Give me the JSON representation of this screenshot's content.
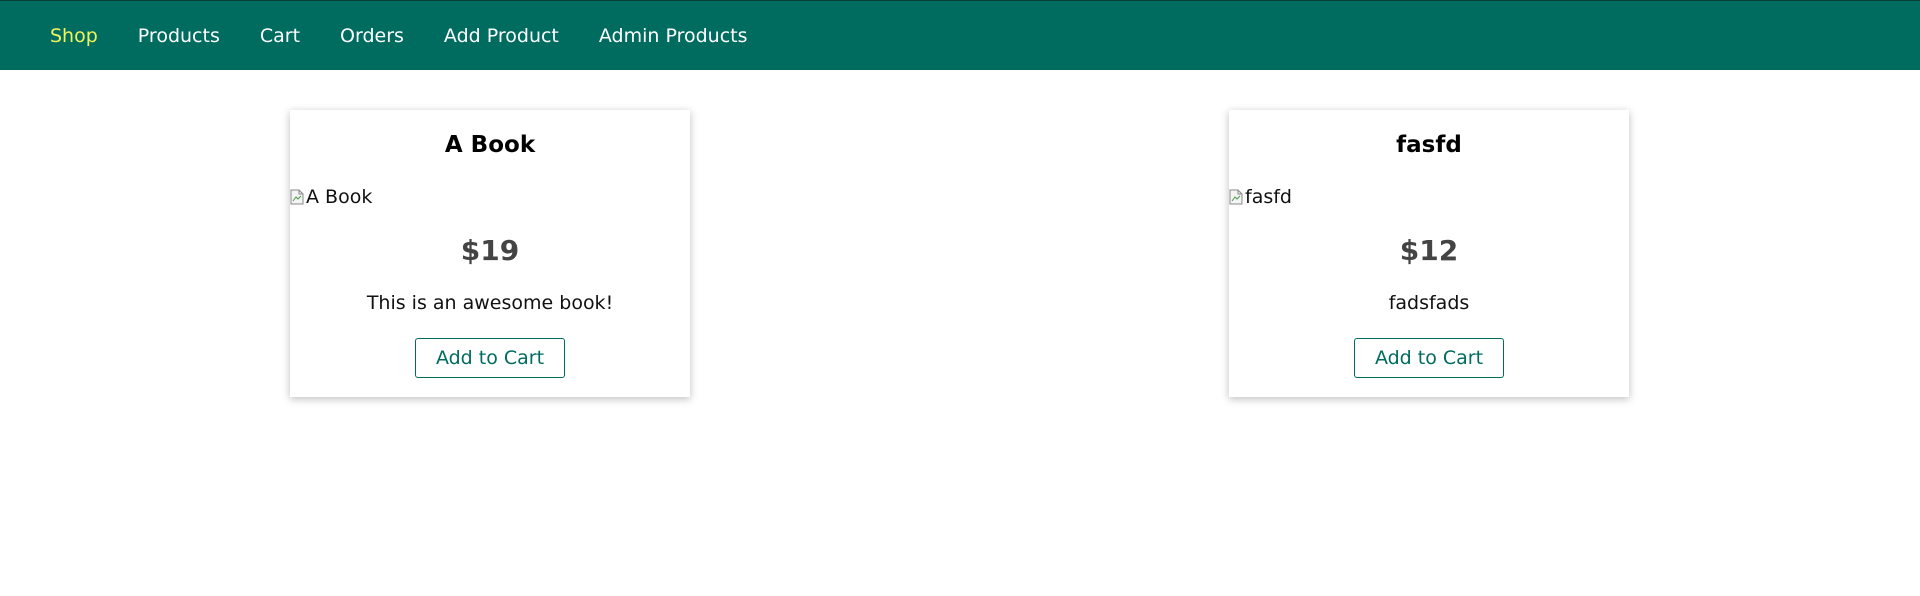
{
  "nav": {
    "items": [
      {
        "label": "Shop",
        "active": true
      },
      {
        "label": "Products",
        "active": false
      },
      {
        "label": "Cart",
        "active": false
      },
      {
        "label": "Orders",
        "active": false
      },
      {
        "label": "Add Product",
        "active": false
      },
      {
        "label": "Admin Products",
        "active": false
      }
    ]
  },
  "products": [
    {
      "title": "A Book",
      "image_alt": "A Book",
      "price": "$19",
      "description": "This is an awesome book!",
      "button_label": "Add to Cart"
    },
    {
      "title": "fasfd",
      "image_alt": "fasfd",
      "price": "$12",
      "description": "fadsfads",
      "button_label": "Add to Cart"
    }
  ],
  "colors": {
    "header_bg": "#006b5f",
    "nav_active": "#f1f55a",
    "nav_text": "#ffffff",
    "button_accent": "#006b5f",
    "price_text": "#444444"
  },
  "icons": {
    "broken_image": "broken-image-icon"
  }
}
